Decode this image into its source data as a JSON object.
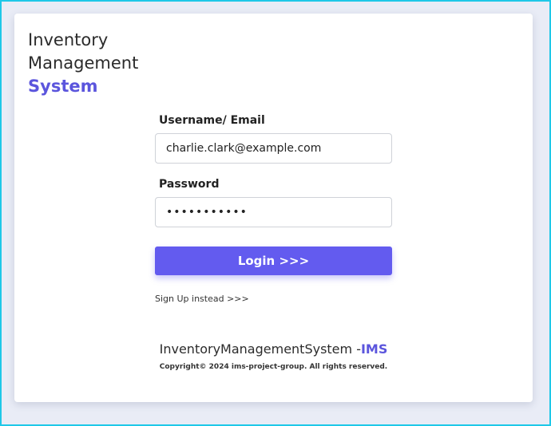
{
  "brand": {
    "line1": "Inventory",
    "line2": "Management",
    "line3": "System"
  },
  "form": {
    "username_label": "Username/ Email",
    "username_value": "charlie.clark@example.com",
    "password_label": "Password",
    "password_value": "•••••••••••",
    "login_label": "Login >>>",
    "signup_label": "Sign Up instead >>>"
  },
  "footer": {
    "title_main": "InventoryManagementSystem -",
    "title_accent": "IMS",
    "copyright": "Copyright© 2024 ims-project-group. All rights reserved."
  },
  "colors": {
    "accent": "#5b55dd",
    "button": "#635bef",
    "page_bg": "#e9ecf6",
    "frame": "#1fc8e8"
  }
}
